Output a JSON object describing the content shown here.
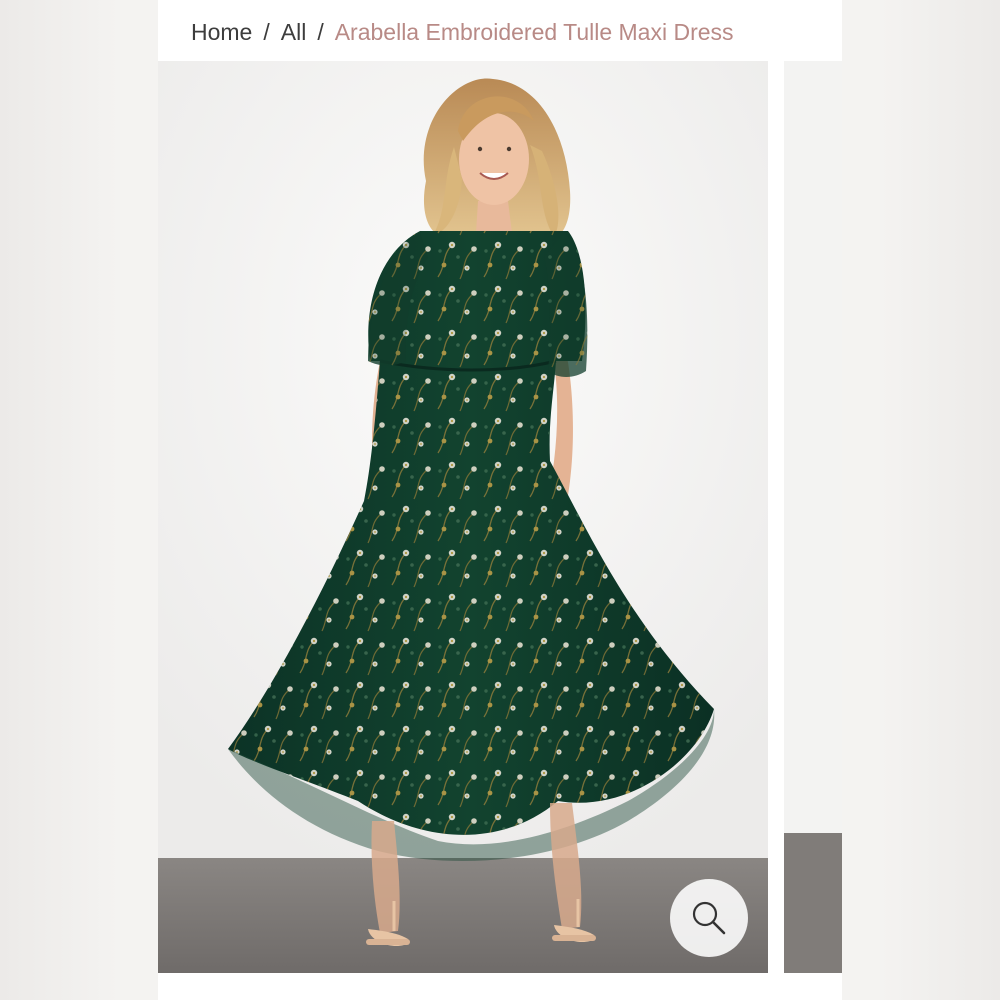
{
  "breadcrumb": {
    "home": "Home",
    "all": "All",
    "separator": "/",
    "current": "Arabella Embroidered Tulle Maxi Dress"
  },
  "product": {
    "main_image_subject": "Woman wearing a dark green embroidered tulle maxi dress with floral pattern and nude heeled sandals",
    "dress_color": "#0f3a2a",
    "floor_color": "#7c7875",
    "wall_color": "#f4f4f3"
  },
  "controls": {
    "zoom_icon": "magnifier-icon"
  },
  "colors": {
    "breadcrumb_text": "#3d3d3d",
    "breadcrumb_current": "#b88a86"
  }
}
